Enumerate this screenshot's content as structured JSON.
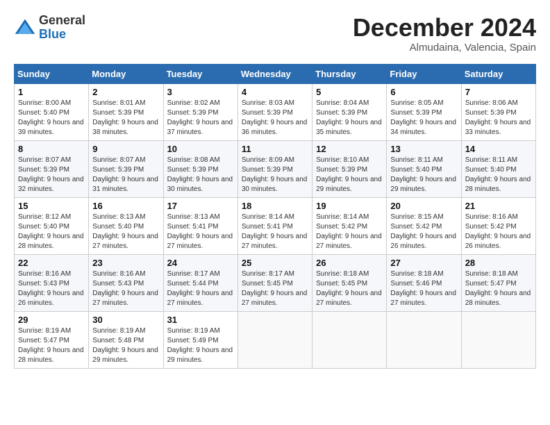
{
  "header": {
    "logo": {
      "general": "General",
      "blue": "Blue"
    },
    "title": "December 2024",
    "subtitle": "Almudaina, Valencia, Spain"
  },
  "weekdays": [
    "Sunday",
    "Monday",
    "Tuesday",
    "Wednesday",
    "Thursday",
    "Friday",
    "Saturday"
  ],
  "weeks": [
    [
      {
        "day": "1",
        "sunrise": "Sunrise: 8:00 AM",
        "sunset": "Sunset: 5:40 PM",
        "daylight": "Daylight: 9 hours and 39 minutes."
      },
      {
        "day": "2",
        "sunrise": "Sunrise: 8:01 AM",
        "sunset": "Sunset: 5:39 PM",
        "daylight": "Daylight: 9 hours and 38 minutes."
      },
      {
        "day": "3",
        "sunrise": "Sunrise: 8:02 AM",
        "sunset": "Sunset: 5:39 PM",
        "daylight": "Daylight: 9 hours and 37 minutes."
      },
      {
        "day": "4",
        "sunrise": "Sunrise: 8:03 AM",
        "sunset": "Sunset: 5:39 PM",
        "daylight": "Daylight: 9 hours and 36 minutes."
      },
      {
        "day": "5",
        "sunrise": "Sunrise: 8:04 AM",
        "sunset": "Sunset: 5:39 PM",
        "daylight": "Daylight: 9 hours and 35 minutes."
      },
      {
        "day": "6",
        "sunrise": "Sunrise: 8:05 AM",
        "sunset": "Sunset: 5:39 PM",
        "daylight": "Daylight: 9 hours and 34 minutes."
      },
      {
        "day": "7",
        "sunrise": "Sunrise: 8:06 AM",
        "sunset": "Sunset: 5:39 PM",
        "daylight": "Daylight: 9 hours and 33 minutes."
      }
    ],
    [
      {
        "day": "8",
        "sunrise": "Sunrise: 8:07 AM",
        "sunset": "Sunset: 5:39 PM",
        "daylight": "Daylight: 9 hours and 32 minutes."
      },
      {
        "day": "9",
        "sunrise": "Sunrise: 8:07 AM",
        "sunset": "Sunset: 5:39 PM",
        "daylight": "Daylight: 9 hours and 31 minutes."
      },
      {
        "day": "10",
        "sunrise": "Sunrise: 8:08 AM",
        "sunset": "Sunset: 5:39 PM",
        "daylight": "Daylight: 9 hours and 30 minutes."
      },
      {
        "day": "11",
        "sunrise": "Sunrise: 8:09 AM",
        "sunset": "Sunset: 5:39 PM",
        "daylight": "Daylight: 9 hours and 30 minutes."
      },
      {
        "day": "12",
        "sunrise": "Sunrise: 8:10 AM",
        "sunset": "Sunset: 5:39 PM",
        "daylight": "Daylight: 9 hours and 29 minutes."
      },
      {
        "day": "13",
        "sunrise": "Sunrise: 8:11 AM",
        "sunset": "Sunset: 5:40 PM",
        "daylight": "Daylight: 9 hours and 29 minutes."
      },
      {
        "day": "14",
        "sunrise": "Sunrise: 8:11 AM",
        "sunset": "Sunset: 5:40 PM",
        "daylight": "Daylight: 9 hours and 28 minutes."
      }
    ],
    [
      {
        "day": "15",
        "sunrise": "Sunrise: 8:12 AM",
        "sunset": "Sunset: 5:40 PM",
        "daylight": "Daylight: 9 hours and 28 minutes."
      },
      {
        "day": "16",
        "sunrise": "Sunrise: 8:13 AM",
        "sunset": "Sunset: 5:40 PM",
        "daylight": "Daylight: 9 hours and 27 minutes."
      },
      {
        "day": "17",
        "sunrise": "Sunrise: 8:13 AM",
        "sunset": "Sunset: 5:41 PM",
        "daylight": "Daylight: 9 hours and 27 minutes."
      },
      {
        "day": "18",
        "sunrise": "Sunrise: 8:14 AM",
        "sunset": "Sunset: 5:41 PM",
        "daylight": "Daylight: 9 hours and 27 minutes."
      },
      {
        "day": "19",
        "sunrise": "Sunrise: 8:14 AM",
        "sunset": "Sunset: 5:42 PM",
        "daylight": "Daylight: 9 hours and 27 minutes."
      },
      {
        "day": "20",
        "sunrise": "Sunrise: 8:15 AM",
        "sunset": "Sunset: 5:42 PM",
        "daylight": "Daylight: 9 hours and 26 minutes."
      },
      {
        "day": "21",
        "sunrise": "Sunrise: 8:16 AM",
        "sunset": "Sunset: 5:42 PM",
        "daylight": "Daylight: 9 hours and 26 minutes."
      }
    ],
    [
      {
        "day": "22",
        "sunrise": "Sunrise: 8:16 AM",
        "sunset": "Sunset: 5:43 PM",
        "daylight": "Daylight: 9 hours and 26 minutes."
      },
      {
        "day": "23",
        "sunrise": "Sunrise: 8:16 AM",
        "sunset": "Sunset: 5:43 PM",
        "daylight": "Daylight: 9 hours and 27 minutes."
      },
      {
        "day": "24",
        "sunrise": "Sunrise: 8:17 AM",
        "sunset": "Sunset: 5:44 PM",
        "daylight": "Daylight: 9 hours and 27 minutes."
      },
      {
        "day": "25",
        "sunrise": "Sunrise: 8:17 AM",
        "sunset": "Sunset: 5:45 PM",
        "daylight": "Daylight: 9 hours and 27 minutes."
      },
      {
        "day": "26",
        "sunrise": "Sunrise: 8:18 AM",
        "sunset": "Sunset: 5:45 PM",
        "daylight": "Daylight: 9 hours and 27 minutes."
      },
      {
        "day": "27",
        "sunrise": "Sunrise: 8:18 AM",
        "sunset": "Sunset: 5:46 PM",
        "daylight": "Daylight: 9 hours and 27 minutes."
      },
      {
        "day": "28",
        "sunrise": "Sunrise: 8:18 AM",
        "sunset": "Sunset: 5:47 PM",
        "daylight": "Daylight: 9 hours and 28 minutes."
      }
    ],
    [
      {
        "day": "29",
        "sunrise": "Sunrise: 8:19 AM",
        "sunset": "Sunset: 5:47 PM",
        "daylight": "Daylight: 9 hours and 28 minutes."
      },
      {
        "day": "30",
        "sunrise": "Sunrise: 8:19 AM",
        "sunset": "Sunset: 5:48 PM",
        "daylight": "Daylight: 9 hours and 29 minutes."
      },
      {
        "day": "31",
        "sunrise": "Sunrise: 8:19 AM",
        "sunset": "Sunset: 5:49 PM",
        "daylight": "Daylight: 9 hours and 29 minutes."
      },
      null,
      null,
      null,
      null
    ]
  ]
}
